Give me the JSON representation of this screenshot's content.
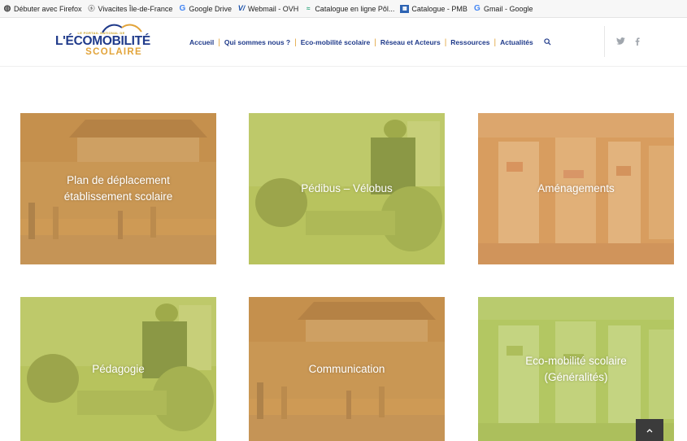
{
  "bookmarks": [
    {
      "label": "Débuter avec Firefox",
      "icon": "firefox-icon"
    },
    {
      "label": "Vivacites Île-de-France",
      "icon": "rss-icon"
    },
    {
      "label": "Google Drive",
      "icon": "google-icon"
    },
    {
      "label": "Webmail - OVH",
      "icon": "ovh-icon"
    },
    {
      "label": "Catalogue en ligne Pôl...",
      "icon": "pol-icon"
    },
    {
      "label": "Catalogue - PMB",
      "icon": "pmb-icon"
    },
    {
      "label": "Gmail - Google",
      "icon": "google-icon"
    }
  ],
  "logo": {
    "top": "LE PORTAIL NATIONAL DE",
    "main": "L'ÉCOMOBILITÉ",
    "sub": "SCOLAIRE",
    "colors": {
      "blue": "#1f3a8a",
      "gold": "#e2a43a"
    }
  },
  "nav": {
    "items": [
      "Accueil",
      "Qui sommes nous ?",
      "Eco-mobilité scolaire",
      "Réseau et Acteurs",
      "Ressources",
      "Actualités"
    ],
    "search_icon": "search-icon"
  },
  "social": {
    "twitter_icon": "twitter-icon",
    "facebook_icon": "facebook-icon"
  },
  "tiles": [
    {
      "line1": "Plan de déplacement",
      "line2": "établissement scolaire",
      "overlay": "#d4a05a"
    },
    {
      "line1": "Pédibus – Vélobus",
      "line2": "",
      "overlay": "#b7c45c"
    },
    {
      "line1": "Aménagements",
      "line2": "",
      "overlay": "#dca163"
    },
    {
      "line1": "Pédagogie",
      "line2": "",
      "overlay": "#b7c45c"
    },
    {
      "line1": "Communication",
      "line2": "",
      "overlay": "#d4a05a"
    },
    {
      "line1": "Eco-mobilité scolaire",
      "line2": "(Généralités)",
      "overlay": "#b4c763"
    }
  ],
  "scroll_top_icon": "chevron-up-icon"
}
